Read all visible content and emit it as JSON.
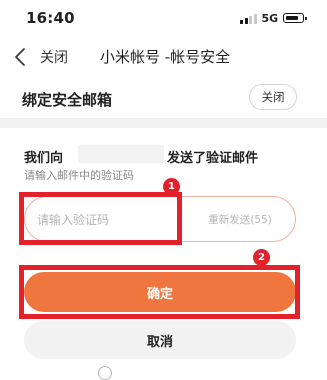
{
  "status_bar": {
    "time": "16:40",
    "network": "5G"
  },
  "nav": {
    "close_label": "关闭",
    "title": "小米帐号 -帐号安全"
  },
  "header": {
    "title": "绑定安全邮箱",
    "close_button": "关闭"
  },
  "message": {
    "prefix": "我们向",
    "suffix": "发送了验证邮件",
    "hint": "请输入邮件中的验证码"
  },
  "code_input": {
    "placeholder": "请输入验证码",
    "value": "",
    "resend_label": "重新发送(55)"
  },
  "buttons": {
    "confirm": "确定",
    "cancel": "取消"
  },
  "annotations": [
    {
      "number": "1"
    },
    {
      "number": "2"
    }
  ],
  "colors": {
    "accent": "#f07640",
    "annotation": "#e3212b",
    "input_border": "#f4b4a6"
  }
}
